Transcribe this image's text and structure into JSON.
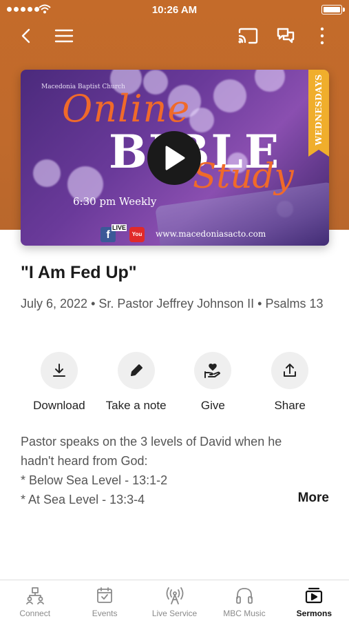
{
  "status_bar": {
    "time": "10:26 AM"
  },
  "nav": {
    "icons": [
      "back-chevron-icon",
      "menu-icon",
      "cast-icon",
      "chat-icon",
      "more-vertical-icon"
    ]
  },
  "video": {
    "church_name": "Macedonia Baptist Church",
    "title_line1": "Online",
    "title_line2": "BIBLE",
    "title_line3": "Study",
    "schedule": "6:30 pm Weekly",
    "ribbon": "WEDNESDAYS",
    "live_label": "LIVE",
    "youtube_label": "You Tube",
    "website": "www.macedoniasacto.com",
    "facebook_letter": "f"
  },
  "sermon": {
    "title": "\"I Am Fed Up\"",
    "meta": "July 6, 2022 • Sr. Pastor Jeffrey Johnson II • Psalms 13",
    "description_lines": [
      "Pastor speaks on the 3 levels of David when he",
      "hadn't heard from God:",
      "* Below Sea Level - 13:1-2",
      "* At Sea Level - 13:3-4"
    ],
    "more_label": "More"
  },
  "actions": [
    {
      "label": "Download",
      "icon": "download-icon"
    },
    {
      "label": "Take a note",
      "icon": "pencil-icon"
    },
    {
      "label": "Give",
      "icon": "giving-hand-icon"
    },
    {
      "label": "Share",
      "icon": "share-icon"
    }
  ],
  "tabs": [
    {
      "label": "Connect",
      "icon": "people-icon",
      "active": false
    },
    {
      "label": "Events",
      "icon": "calendar-icon",
      "active": false
    },
    {
      "label": "Live Service",
      "icon": "broadcast-icon",
      "active": false
    },
    {
      "label": "MBC Music",
      "icon": "headphones-icon",
      "active": false
    },
    {
      "label": "Sermons",
      "icon": "sermons-play-icon",
      "active": true
    }
  ],
  "colors": {
    "header": "#c46b2a",
    "accent_orange": "#f06a2a",
    "ribbon": "#f0ae2c"
  }
}
